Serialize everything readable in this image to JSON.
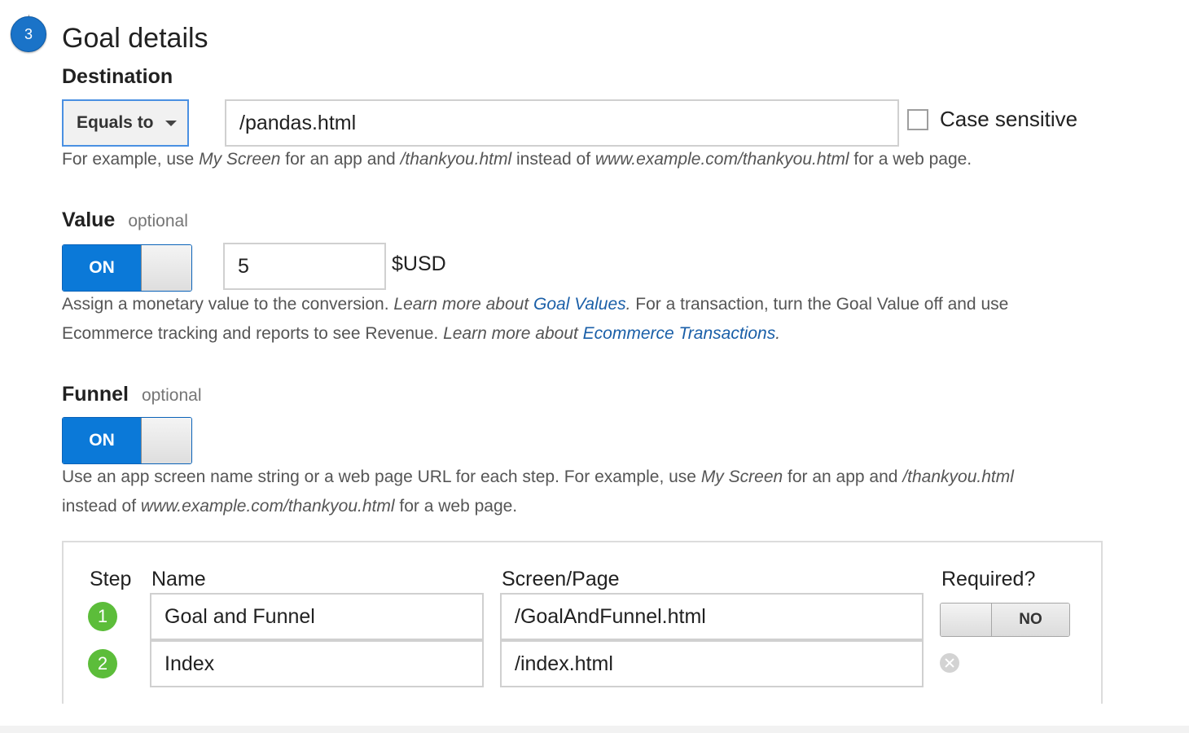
{
  "header": {
    "step_number": "3",
    "title": "Goal details"
  },
  "destination": {
    "label": "Destination",
    "match_type": "Equals to",
    "value": "/pandas.html",
    "case_sensitive_label": "Case sensitive",
    "case_sensitive_checked": false,
    "help": {
      "t1": "For example, use ",
      "i1": "My Screen",
      "t2": " for an app and ",
      "i2": "/thankyou.html",
      "t3": " instead of ",
      "i3": "www.example.com/thankyou.html",
      "t4": " for a web page."
    }
  },
  "value": {
    "label": "Value",
    "optional": "optional",
    "toggle_label": "ON",
    "amount": "5",
    "currency": "$USD",
    "help": {
      "t1": "Assign a monetary value to the conversion. ",
      "i1": "Learn more about ",
      "link1": "Goal Values",
      "i2": ".",
      "t2": " For a transaction, turn the Goal Value off and use",
      "t3": "Ecommerce tracking and reports to see Revenue. ",
      "i3": "Learn more about ",
      "link2": "Ecommerce Transactions",
      "i4": "."
    }
  },
  "funnel": {
    "label": "Funnel",
    "optional": "optional",
    "toggle_label": "ON",
    "help": {
      "t1": "Use an app screen name string or a web page URL for each step. For example, use ",
      "i1": "My Screen",
      "t2": " for an app and ",
      "i2": "/thankyou.html",
      "t3": "instead of ",
      "i3": "www.example.com/thankyou.html",
      "t4": " for a web page."
    },
    "columns": {
      "step": "Step",
      "name": "Name",
      "screen": "Screen/Page",
      "required": "Required?"
    },
    "required_toggle": "NO",
    "steps": [
      {
        "num": "1",
        "name": "Goal and Funnel",
        "screen": "/GoalAndFunnel.html"
      },
      {
        "num": "2",
        "name": "Index",
        "screen": "/index.html"
      }
    ]
  }
}
